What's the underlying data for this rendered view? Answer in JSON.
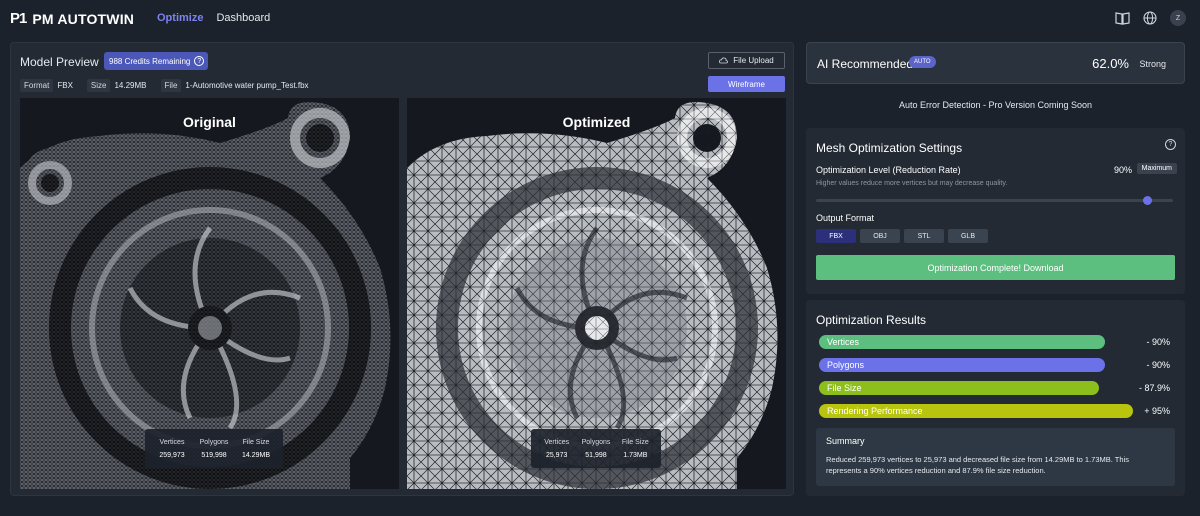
{
  "header": {
    "logo_mark": "P1",
    "logo_text": "PM AUTOTWIN",
    "nav": [
      {
        "label": "Optimize",
        "active": true
      },
      {
        "label": "Dashboard",
        "active": false
      }
    ],
    "icons": [
      "book-icon",
      "globe-icon",
      "avatar-icon"
    ],
    "avatar_initial": "Z"
  },
  "model_preview": {
    "title": "Model Preview",
    "credits_label": "988 Credits Remaining",
    "format_label": "Format",
    "format_value": "FBX",
    "size_label": "Size",
    "size_value": "14.29MB",
    "file_label": "File",
    "file_value": "1-Automotive water pump_Test.fbx",
    "file_upload_label": "File Upload",
    "wireframe_label": "Wireframe",
    "original": {
      "title": "Original",
      "vertices_label": "Vertices",
      "vertices": "259,973",
      "polygons_label": "Polygons",
      "polygons": "519,998",
      "filesize_label": "File Size",
      "filesize": "14.29MB"
    },
    "optimized": {
      "title": "Optimized",
      "vertices_label": "Vertices",
      "vertices": "25,973",
      "polygons_label": "Polygons",
      "polygons": "51,998",
      "filesize_label": "File Size",
      "filesize": "1.73MB"
    }
  },
  "ai": {
    "title": "AI Recommended",
    "badge": "AUTO",
    "percent": "62.0%",
    "strength": "Strong",
    "auto_error": "Auto Error Detection - Pro Version Coming Soon"
  },
  "mesh_settings": {
    "title": "Mesh Optimization Settings",
    "help": "?",
    "level_label": "Optimization Level (Reduction Rate)",
    "level_value": "90%",
    "level_badge": "Maximum",
    "hint": "Higher values reduce more vertices but may decrease quality.",
    "slider_fraction": 0.94,
    "output_format_label": "Output Format",
    "formats": [
      {
        "label": "FBX",
        "active": true
      },
      {
        "label": "OBJ",
        "active": false
      },
      {
        "label": "STL",
        "active": false
      },
      {
        "label": "GLB",
        "active": false
      }
    ],
    "download_label": "Optimization Complete! Download"
  },
  "results": {
    "title": "Optimization Results",
    "bars": [
      {
        "label": "Vertices",
        "value": "- 90%",
        "fill": 0.9,
        "color": "#5dbf7f"
      },
      {
        "label": "Polygons",
        "value": "- 90%",
        "fill": 0.9,
        "color": "#6b72e8"
      },
      {
        "label": "File Size",
        "value": "- 87.9%",
        "fill": 0.88,
        "color": "#8dbf1c"
      },
      {
        "label": "Rendering Performance",
        "value": "+ 95%",
        "fill": 0.95,
        "color": "#b8c40e"
      }
    ],
    "summary_title": "Summary",
    "summary_text": "Reduced 259,973 vertices to 25,973 and decreased file size from 14.29MB to 1.73MB. This represents a 90% vertices reduction and 87.9% file size reduction."
  },
  "colors": {
    "accent": "#6b72e8",
    "success": "#5dbf7f",
    "background": "#1c222b",
    "panel": "#232a34"
  }
}
